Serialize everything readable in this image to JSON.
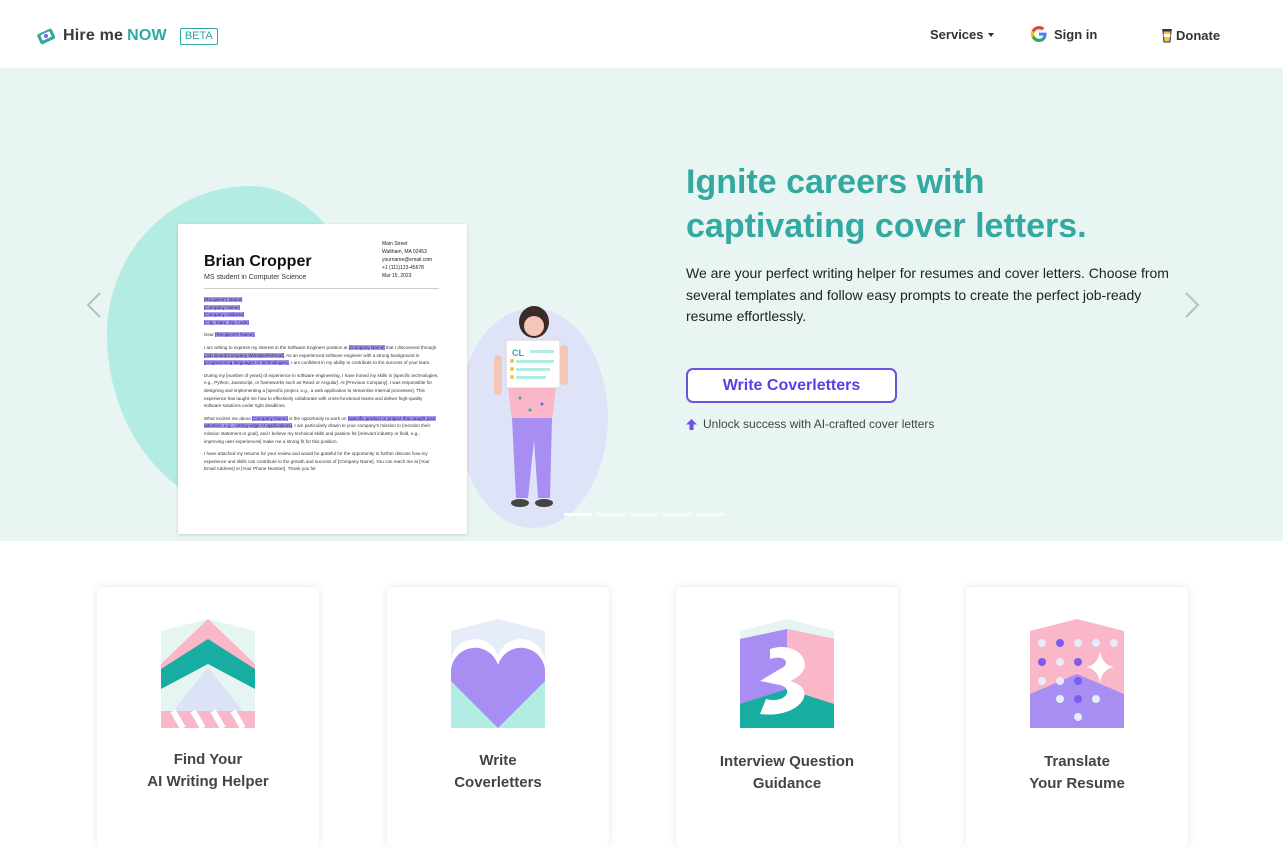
{
  "header": {
    "brand_part1": "Hire me",
    "brand_part2": "NOW",
    "beta_badge": "BETA",
    "nav_services": "Services",
    "nav_signin": "Sign in",
    "nav_donate": "Donate"
  },
  "hero": {
    "title_line1": "Ignite careers with",
    "title_line2": "captivating cover letters.",
    "description": "We are your perfect writing helper for resumes and cover letters. Choose from several templates and follow easy prompts to create the perfect job-ready resume effortlessly.",
    "cta_label": "Write Coverletters",
    "hint": "Unlock success with AI-crafted cover letters",
    "carousel_slides": 5,
    "active_slide": 1,
    "figure_badge": "CL",
    "doc": {
      "name": "Brian Cropper",
      "subtitle": "MS student in Computer Science",
      "address_lines": [
        "Main Street",
        "Waltham, MA 02453",
        "yourname@email.com",
        "+1 (111)123-45678",
        "Mar 15, 2023"
      ],
      "recipient_lines": [
        "[Recipient's Name]",
        "[Company Name]",
        "[Company Address]",
        "[City, State, Zip Code]"
      ],
      "greeting_prefix": "Dear",
      "greeting_hl": "[Recipient's Name],",
      "para1_a": "I am writing to express my interest in the Software Engineer position at",
      "para1_hl1": "[Company Name]",
      "para1_b": "that I discovered through",
      "para1_hl2": "[Job Board/Company Website/Referral]",
      "para1_c": ". As an experienced software engineer with a strong background in",
      "para1_hl3": "[programming languages or technologies]",
      "para1_d": ", I am confident in my ability to contribute to the success of your team.",
      "para2": "During my [number of years] of experience in software engineering, I have honed my skills in [specific technologies, e.g., Python, JavaScript, or frameworks such as React or Angular]. At [Previous Company], I was responsible for designing and implementing a [specific project, e.g., a web application to streamline internal processes]. This experience has taught me how to effectively collaborate with cross-functional teams and deliver high-quality software solutions under tight deadlines.",
      "para3_a": "What excites me about",
      "para3_hl1": "[Company Name]",
      "para3_b": "is the opportunity to work on",
      "para3_hl2": "[specific product or project that caught your attention, e.g., cutting-edge AI applications]",
      "para3_c": ". I am particularly drawn to your company's mission to [mention their mission statement or goal], and I believe my technical skills and passion for [relevant industry or field, e.g., improving user experiences] make me a strong fit for this position.",
      "para4": "I have attached my resume for your review and would be grateful for the opportunity to further discuss how my experience and skills can contribute to the growth and success of [Company Name]. You can reach me at [Your Email Address] or [Your Phone Number]. Thank you for"
    }
  },
  "cards": [
    {
      "line1": "Find Your",
      "line2": "AI Writing Helper"
    },
    {
      "line1": "Write",
      "line2": "Coverletters"
    },
    {
      "line1": "Interview Question",
      "line2": "Guidance"
    },
    {
      "line1": "Translate",
      "line2": "Your Resume"
    }
  ],
  "colors": {
    "brand_teal": "#34a9a1",
    "accent_purple": "#6b52e0",
    "hero_bg": "#e8f5f3"
  }
}
